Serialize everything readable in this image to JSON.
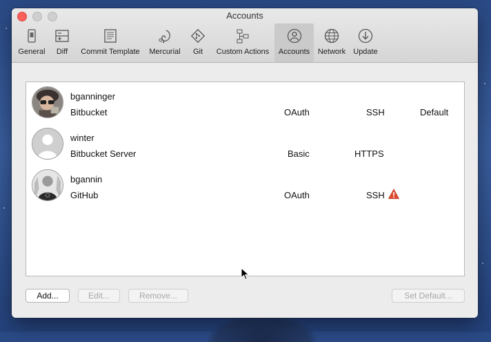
{
  "window": {
    "title": "Accounts"
  },
  "toolbar": {
    "items": [
      {
        "label": "General",
        "icon": "general-icon"
      },
      {
        "label": "Diff",
        "icon": "diff-icon"
      },
      {
        "label": "Commit Template",
        "icon": "commit-template-icon"
      },
      {
        "label": "Mercurial",
        "icon": "mercurial-icon"
      },
      {
        "label": "Git",
        "icon": "git-icon"
      },
      {
        "label": "Custom Actions",
        "icon": "custom-actions-icon"
      },
      {
        "label": "Accounts",
        "icon": "accounts-icon",
        "selected": true
      },
      {
        "label": "Network",
        "icon": "network-icon"
      },
      {
        "label": "Update",
        "icon": "update-icon"
      }
    ]
  },
  "accounts": [
    {
      "username": "bganninger",
      "service": "Bitbucket",
      "auth": "OAuth",
      "protocol": "SSH",
      "default": "Default",
      "warning": false
    },
    {
      "username": "winter",
      "service": "Bitbucket Server",
      "auth": "Basic",
      "protocol": "HTTPS",
      "default": "",
      "warning": false
    },
    {
      "username": "bgannin",
      "service": "GitHub",
      "auth": "OAuth",
      "protocol": "SSH",
      "default": "",
      "warning": true
    }
  ],
  "buttons": {
    "add": "Add...",
    "edit": "Edit...",
    "remove": "Remove...",
    "set_default": "Set Default..."
  },
  "colors": {
    "close_button": "#fc605b",
    "selected_tab": "#cacaca",
    "warning": "#e0492f",
    "desktop": "#2f5193"
  }
}
